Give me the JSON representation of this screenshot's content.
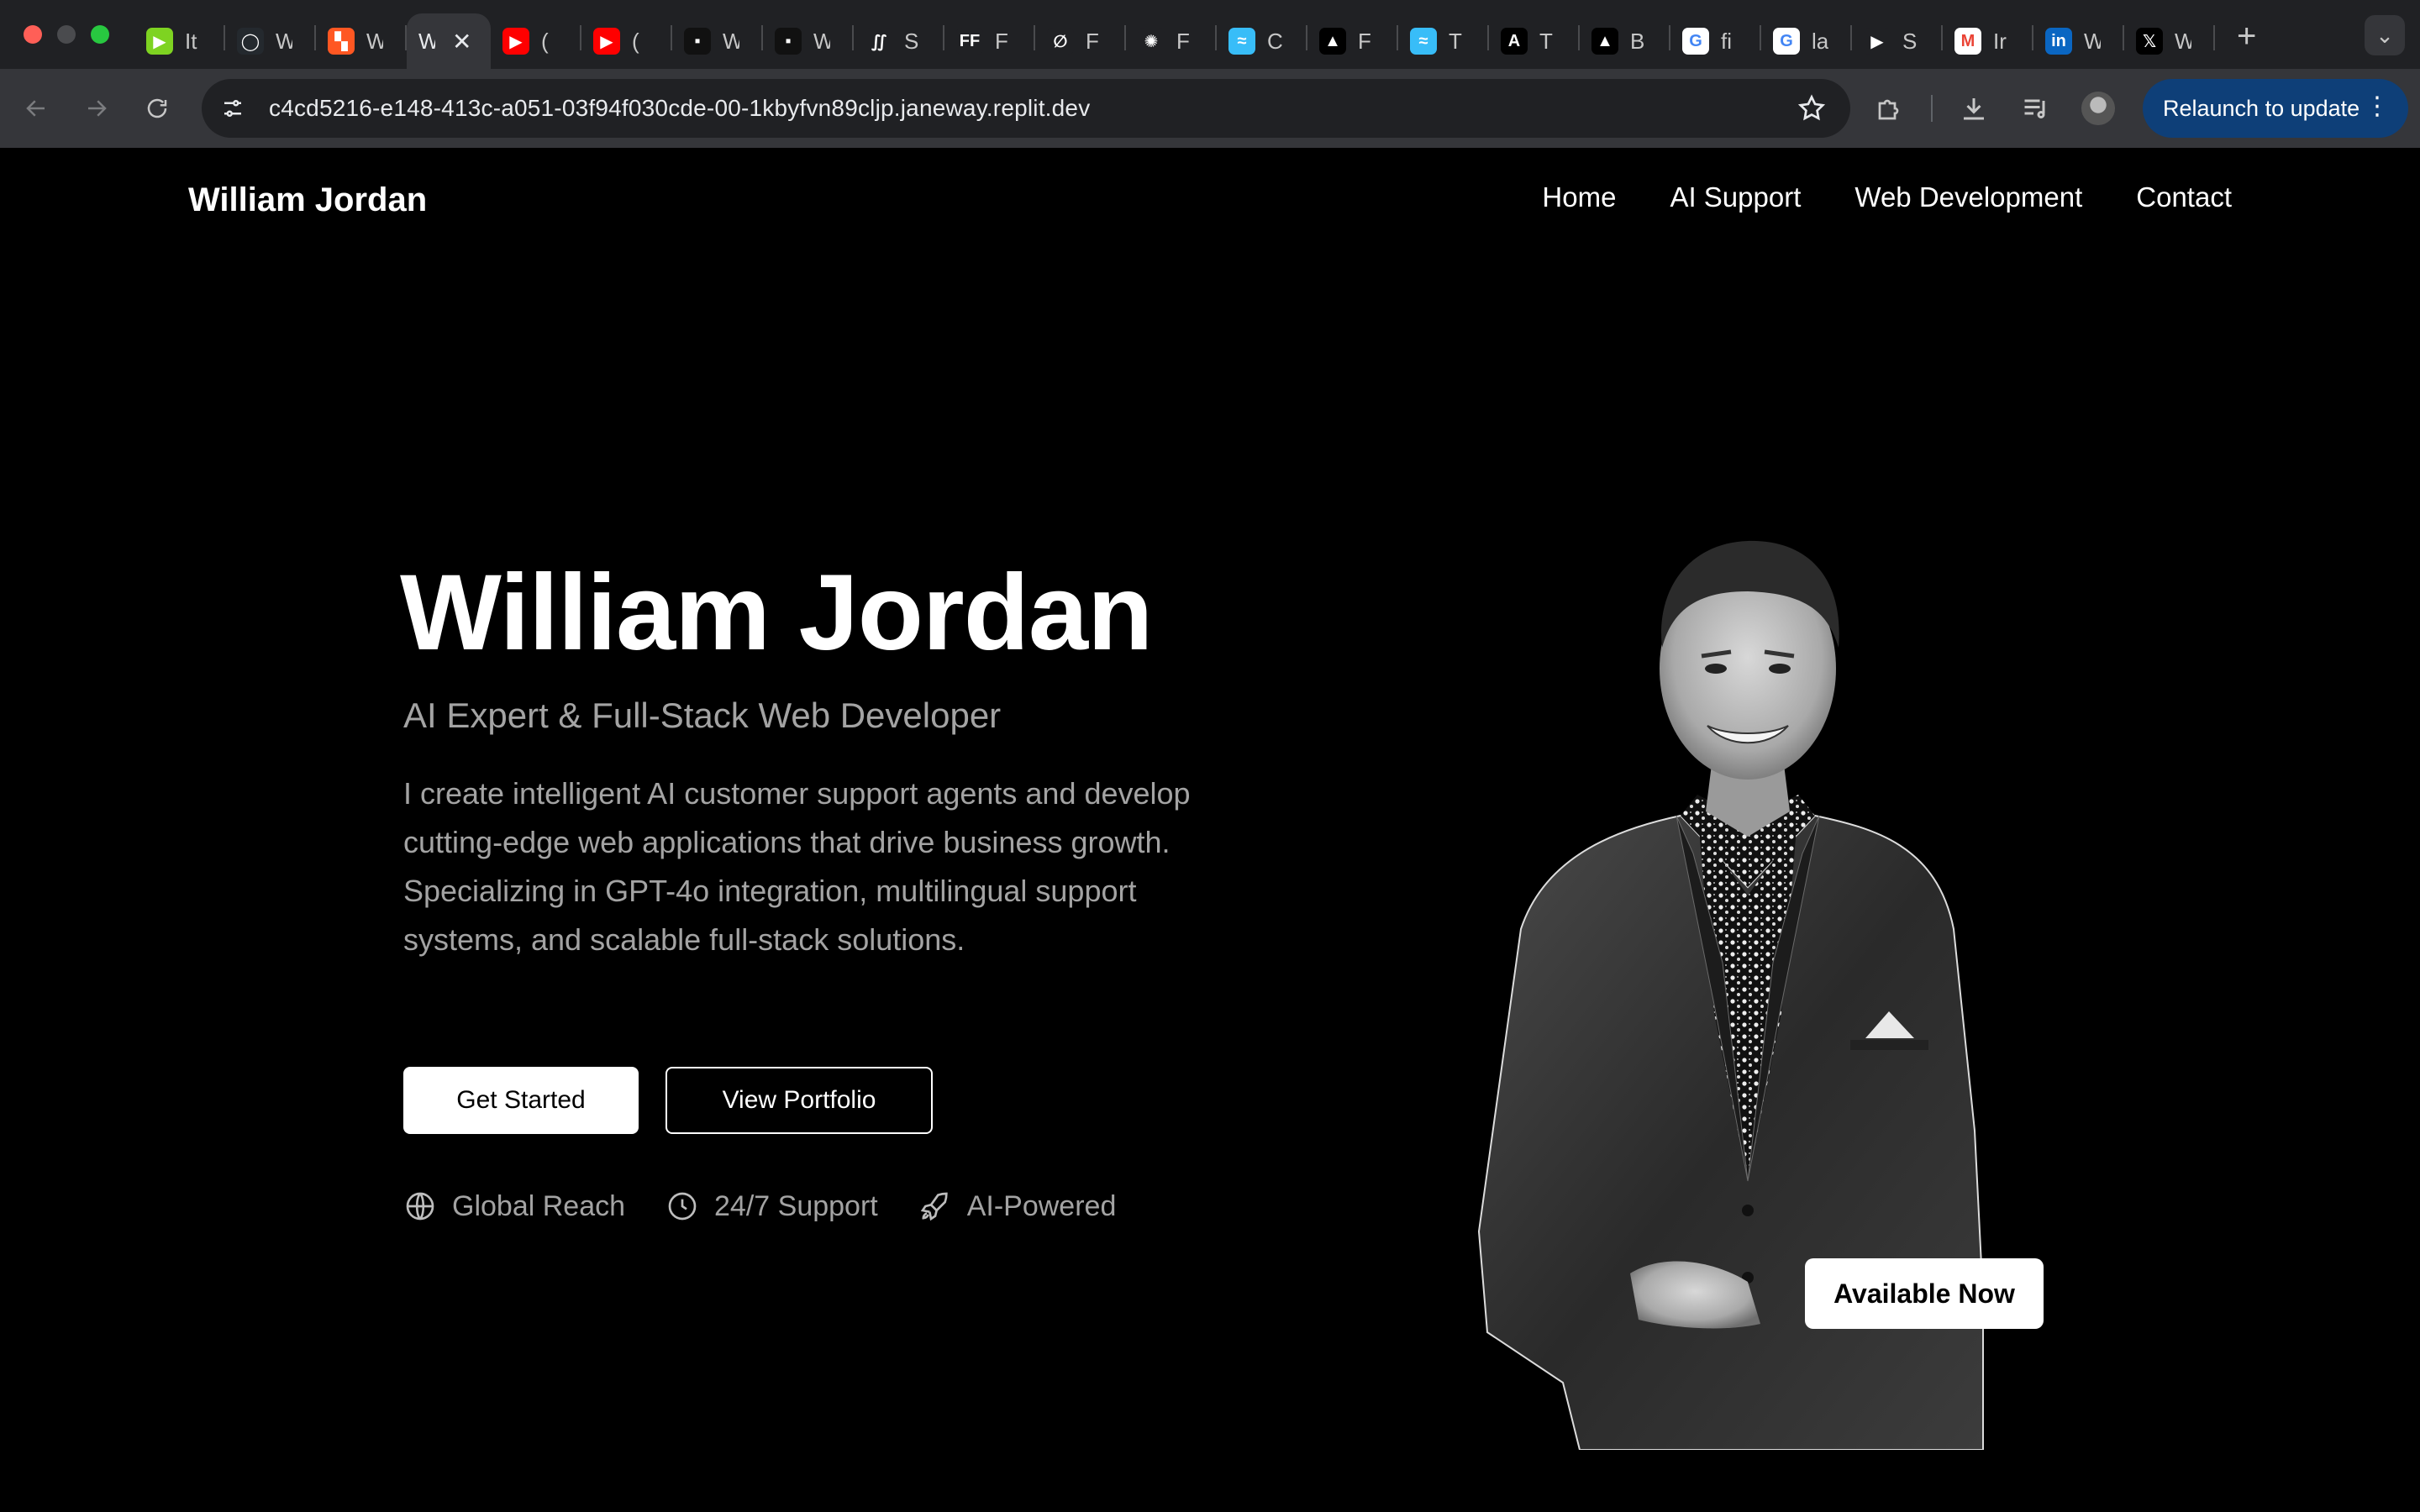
{
  "browser": {
    "tabs": [
      {
        "title": "It",
        "icon": "replit-run-icon",
        "color": "#7ed321",
        "glyph": "▶"
      },
      {
        "title": "W",
        "icon": "github-icon",
        "color": "#24292e",
        "glyph": "◯"
      },
      {
        "title": "W",
        "icon": "grid-logo-icon",
        "color": "#ff5722",
        "glyph": "▚"
      },
      {
        "title": "W",
        "icon": "none",
        "color": "",
        "glyph": "",
        "active": true
      },
      {
        "title": "(",
        "icon": "youtube-icon",
        "color": "#ff0000",
        "glyph": "▶"
      },
      {
        "title": "(",
        "icon": "youtube-icon",
        "color": "#ff0000",
        "glyph": "▶"
      },
      {
        "title": "W",
        "icon": "dark-site-icon",
        "color": "#111111",
        "glyph": "▪"
      },
      {
        "title": "W",
        "icon": "dark-site-icon",
        "color": "#111111",
        "glyph": "▪"
      },
      {
        "title": "S",
        "icon": "squarespace-icon",
        "color": "#202124",
        "glyph": "∬"
      },
      {
        "title": "F",
        "icon": "ff-logo-icon",
        "color": "#202124",
        "glyph": "FF"
      },
      {
        "title": "F",
        "icon": "slash-circle-icon",
        "color": "#202124",
        "glyph": "∅"
      },
      {
        "title": "F",
        "icon": "openai-icon",
        "color": "#202124",
        "glyph": "✺"
      },
      {
        "title": "C",
        "icon": "tailwind-icon",
        "color": "#38bdf8",
        "glyph": "≈"
      },
      {
        "title": "F",
        "icon": "triangle-icon",
        "color": "#000000",
        "glyph": "▲"
      },
      {
        "title": "T",
        "icon": "tailwind-icon",
        "color": "#38bdf8",
        "glyph": "≈"
      },
      {
        "title": "T",
        "icon": "a-logo-icon",
        "color": "#000000",
        "glyph": "A"
      },
      {
        "title": "B",
        "icon": "triangle-icon",
        "color": "#000000",
        "glyph": "▲"
      },
      {
        "title": "fi",
        "icon": "google-icon",
        "color": "#ffffff",
        "glyph": "G"
      },
      {
        "title": "la",
        "icon": "google-icon",
        "color": "#ffffff",
        "glyph": "G"
      },
      {
        "title": "S",
        "icon": "play-circle-icon",
        "color": "#202124",
        "glyph": "▶"
      },
      {
        "title": "Ir",
        "icon": "gmail-icon",
        "color": "#ffffff",
        "glyph": "M"
      },
      {
        "title": "W",
        "icon": "linkedin-icon",
        "color": "#0a66c2",
        "glyph": "in"
      },
      {
        "title": "W",
        "icon": "x-icon",
        "color": "#000000",
        "glyph": "𝕏"
      }
    ],
    "url": "c4cd5216-e148-413c-a051-03f94f030cde-00-1kbyfvn89cljp.janeway.replit.dev",
    "relaunch_label": "Relaunch to update"
  },
  "site": {
    "brand": "William Jordan",
    "nav": [
      "Home",
      "AI Support",
      "Web Development",
      "Contact"
    ]
  },
  "hero": {
    "title": "William Jordan",
    "subtitle": "AI Expert & Full-Stack Web Developer",
    "description": "I create intelligent AI customer support agents and develop cutting-edge web applications that drive business growth. Specializing in GPT-4o integration, multilingual support systems, and scalable full-stack solutions.",
    "primary_button": "Get Started",
    "secondary_button": "View Portfolio",
    "features": [
      {
        "label": "Global Reach",
        "icon": "globe-icon"
      },
      {
        "label": "24/7 Support",
        "icon": "clock-icon"
      },
      {
        "label": "AI-Powered",
        "icon": "rocket-icon"
      }
    ],
    "badge": "Available Now"
  }
}
